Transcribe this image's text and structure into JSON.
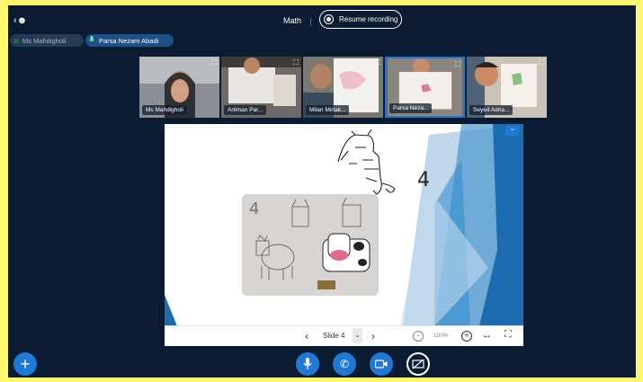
{
  "header": {
    "meeting_title": "Math",
    "record_label": "Resume recording"
  },
  "talkers": [
    {
      "name": "Ms Mahdigholi",
      "active": false
    },
    {
      "name": "Parsa Nezam Abadi",
      "active": true
    }
  ],
  "videos": [
    {
      "label": "Ms Mahdigholi",
      "active": false
    },
    {
      "label": "Artiman Par...",
      "active": false
    },
    {
      "label": "Milan Mirtak...",
      "active": false
    },
    {
      "label": "Parsa Neza...",
      "active": true
    },
    {
      "label": "Seyed Adria...",
      "active": false
    }
  ],
  "presentation": {
    "slide_label": "Slide 4",
    "zoom": "100%",
    "handwritten_digit": "4",
    "drawing_digits": "4"
  },
  "colors": {
    "accent": "#1f79d3",
    "background": "#0b1b31",
    "frame": "#fdf86f"
  }
}
